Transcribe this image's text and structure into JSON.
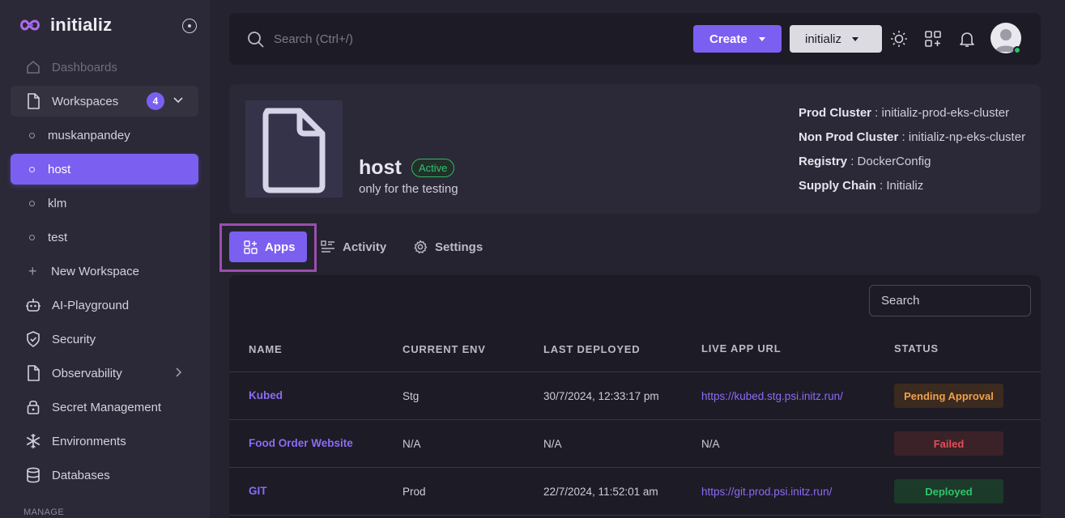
{
  "brand": {
    "name": "initializ"
  },
  "sidebar": {
    "items": [
      {
        "label": "Dashboards"
      },
      {
        "label": "Workspaces",
        "count": "4"
      },
      {
        "label": "muskanpandey"
      },
      {
        "label": "host"
      },
      {
        "label": "klm"
      },
      {
        "label": "test"
      },
      {
        "label": "New Workspace"
      },
      {
        "label": "AI-Playground"
      },
      {
        "label": "Security"
      },
      {
        "label": "Observability"
      },
      {
        "label": "Secret Management"
      },
      {
        "label": "Environments"
      },
      {
        "label": "Databases"
      }
    ],
    "section_manage": "MANAGE"
  },
  "topbar": {
    "search_placeholder": "Search (Ctrl+/)",
    "create_label": "Create",
    "workspace_select": "initializ"
  },
  "workspace": {
    "title": "host",
    "status": "Active",
    "description": "only for the testing",
    "meta": [
      {
        "key": "Prod Cluster",
        "value": "initializ-prod-eks-cluster"
      },
      {
        "key": "Non Prod Cluster",
        "value": "initializ-np-eks-cluster"
      },
      {
        "key": "Registry",
        "value": "DockerConfig"
      },
      {
        "key": "Supply Chain",
        "value": "Initializ"
      }
    ]
  },
  "tabs": [
    {
      "label": "Apps"
    },
    {
      "label": "Activity"
    },
    {
      "label": "Settings"
    }
  ],
  "table": {
    "search_placeholder": "Search",
    "columns": [
      "NAME",
      "CURRENT ENV",
      "LAST DEPLOYED",
      "LIVE APP URL",
      "STATUS"
    ],
    "rows": [
      {
        "name": "Kubed",
        "env": "Stg",
        "deployed": "30/7/2024, 12:33:17 pm",
        "url": "https://kubed.stg.psi.initz.run/",
        "status": "Pending Approval"
      },
      {
        "name": "Food Order Website",
        "env": "N/A",
        "deployed": "N/A",
        "url": "N/A",
        "status": "Failed"
      },
      {
        "name": "GIT",
        "env": "Prod",
        "deployed": "22/7/2024, 11:52:01 am",
        "url": "https://git.prod.psi.initz.run/",
        "status": "Deployed"
      }
    ]
  },
  "colors": {
    "accent": "#7b5ff0",
    "pending": "#f0a04b",
    "failed": "#e0505a",
    "deployed": "#2fc46b"
  }
}
